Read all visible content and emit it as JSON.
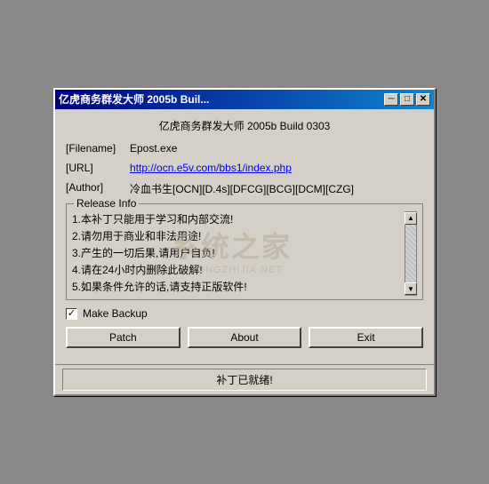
{
  "window": {
    "title": "亿虎商务群发大师 2005b Buil...",
    "minimize_btn": "─",
    "maximize_btn": "□",
    "close_btn": "✕"
  },
  "header": {
    "app_title": "亿虎商务群发大师 2005b Build 0303"
  },
  "fields": {
    "filename_label": "[Filename]",
    "filename_value": "Epost.exe",
    "url_label": "[URL]",
    "url_value": "http://ocn.e5v.com/bbs1/index.php",
    "author_label": "[Author]",
    "author_value": "冷血书生[OCN][D.4s][DFCG][BCG][DCM][CZG]"
  },
  "release_info": {
    "legend": "Release Info",
    "lines": [
      "1.本补丁只能用于学习和内部交流!",
      "2.请勿用于商业和非法用途!",
      "3.产生的一切后果,请用户自负!",
      "4.请在24小时内删除此破解!",
      "5.如果条件允许的话,请支持正版软件!"
    ]
  },
  "watermark": {
    "cn": "系统之家",
    "en": "XITONGZHIJIA.NET"
  },
  "checkbox": {
    "label": "Make Backup",
    "checked": true
  },
  "buttons": {
    "patch": "Patch",
    "about": "About",
    "exit": "Exit"
  },
  "status": {
    "text": "补丁已就绪!"
  }
}
